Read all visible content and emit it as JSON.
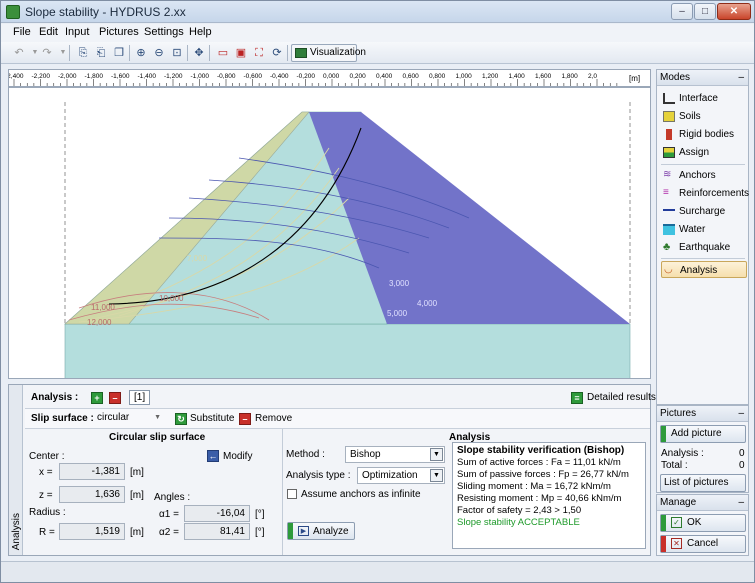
{
  "window": {
    "title": "Slope stability - HYDRUS 2.xx"
  },
  "menu": [
    "File",
    "Edit",
    "Input",
    "Pictures",
    "Settings",
    "Help"
  ],
  "toolbar": {
    "visualization_label": "Visualization"
  },
  "ruler": {
    "unit": "[m]",
    "ticks": [
      "-2,400",
      "-2,200",
      "-2,000",
      "-1,800",
      "-1,600",
      "-1,400",
      "-1,200",
      "-1,000",
      "-0,800",
      "-0,600",
      "-0,400",
      "-0,200",
      "0,000",
      "0,200",
      "0,400",
      "0,600",
      "0,800",
      "1,000",
      "1,200",
      "1,400",
      "1,600",
      "1,800",
      "2,0"
    ]
  },
  "canvas": {
    "contour_labels": [
      "3,000",
      "4,000",
      "5,000",
      "7,000",
      "10,000",
      "11,000",
      "12,000"
    ]
  },
  "analysis": {
    "header_label": "Analysis :",
    "tab_label": "[1]",
    "detailed_results": "Detailed results",
    "slip_surface_label": "Slip surface :",
    "slip_surface_value": "circular",
    "substitute_label": "Substitute",
    "remove_label": "Remove",
    "vertical_tab": "Analysis",
    "circular": {
      "title": "Circular slip surface",
      "center_label": "Center :",
      "modify_label": "Modify",
      "x_label": "x =",
      "x_value": "-1,381",
      "x_unit": "[m]",
      "z_label": "z =",
      "z_value": "1,636",
      "z_unit": "[m]",
      "radius_label": "Radius :",
      "r_label": "R =",
      "r_value": "1,519",
      "r_unit": "[m]",
      "angles_label": "Angles :",
      "a1_label": "α1 =",
      "a1_value": "-16,04",
      "a1_unit": "[°]",
      "a2_label": "α2 =",
      "a2_value": "81,41",
      "a2_unit": "[°]"
    },
    "panel": {
      "title": "Analysis",
      "method_label": "Method :",
      "method_value": "Bishop",
      "type_label": "Analysis type :",
      "type_value": "Optimization",
      "anchors_label": "Assume anchors as infinite",
      "analyze_label": "Analyze"
    },
    "results": {
      "title": "Slope stability verification (Bishop)",
      "line1": "Sum of active forces :     Fa =  11,01 kN/m",
      "line2": "Sum of passive forces :  Fp =  26,77 kN/m",
      "line3": "Sliding moment :            Ma =  16,72 kNm/m",
      "line4": "Resisting moment :         Mp =  40,66 kNm/m",
      "line5": "Factor of safety = 2,43 > 1,50",
      "line6": "Slope stability ACCEPTABLE"
    }
  },
  "modes": {
    "title": "Modes",
    "items": [
      "Interface",
      "Soils",
      "Rigid bodies",
      "Assign",
      "Anchors",
      "Reinforcements",
      "Surcharge",
      "Water",
      "Earthquake",
      "Analysis"
    ]
  },
  "pictures": {
    "title": "Pictures",
    "add_label": "Add picture",
    "analysis_label": "Analysis :",
    "analysis_count": "0",
    "total_label": "Total :",
    "total_count": "0",
    "list_label": "List of pictures"
  },
  "manage": {
    "title": "Manage",
    "ok_label": "OK",
    "cancel_label": "Cancel"
  },
  "colors": {
    "slope_cyan": "#b4dedd",
    "water_blue": "#7273c9",
    "soil_khaki": "#ccd9a4",
    "accent_green": "#2e9a3b"
  }
}
